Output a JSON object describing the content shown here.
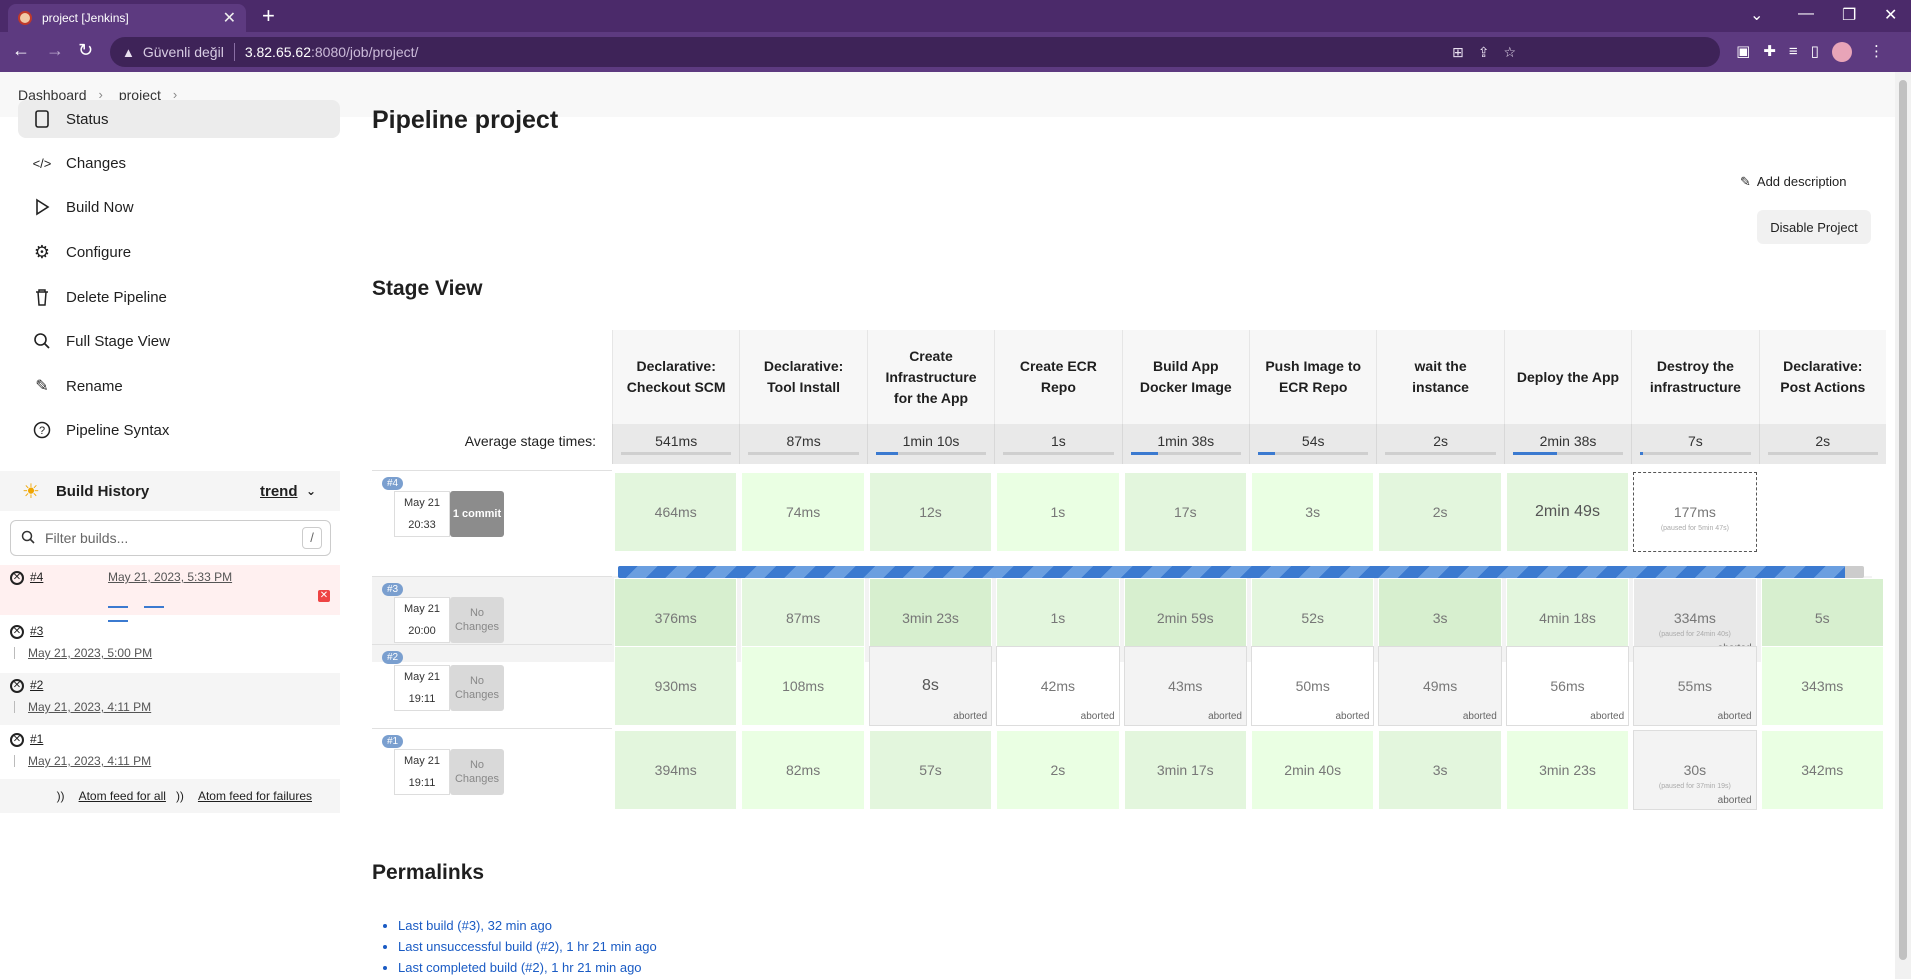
{
  "browser": {
    "tab_title": "project [Jenkins]",
    "security_label": "Güvenli değil",
    "url_host": "3.82.65.62",
    "url_rest": ":8080/job/project/"
  },
  "breadcrumb": [
    "Dashboard",
    "project"
  ],
  "sidebar": {
    "items": [
      {
        "label": "Status",
        "icon": "status-icon"
      },
      {
        "label": "Changes",
        "icon": "code-icon"
      },
      {
        "label": "Build Now",
        "icon": "play-icon"
      },
      {
        "label": "Configure",
        "icon": "gear-icon"
      },
      {
        "label": "Delete Pipeline",
        "icon": "trash-icon"
      },
      {
        "label": "Full Stage View",
        "icon": "search-icon"
      },
      {
        "label": "Rename",
        "icon": "pencil-icon"
      },
      {
        "label": "Pipeline Syntax",
        "icon": "help-icon"
      }
    ],
    "build_history_title": "Build History",
    "trend_label": "trend",
    "filter_placeholder": "Filter builds...",
    "filter_shortcut": "/",
    "builds": [
      {
        "num": "#4",
        "date": "May 21, 2023, 5:33 PM"
      },
      {
        "num": "#3",
        "date": "May 21, 2023, 5:00 PM"
      },
      {
        "num": "#2",
        "date": "May 21, 2023, 4:11 PM"
      },
      {
        "num": "#1",
        "date": "May 21, 2023, 4:11 PM"
      }
    ],
    "feed_all": "Atom feed for all",
    "feed_failures": "Atom feed for failures"
  },
  "main": {
    "title": "Pipeline project",
    "add_description": "Add description",
    "disable_button": "Disable Project",
    "stage_view_title": "Stage View",
    "avg_label": "Average stage times:",
    "permalinks_title": "Permalinks",
    "permalinks": [
      "Last build (#3), 32 min ago",
      "Last unsuccessful build (#2), 1 hr 21 min ago",
      "Last completed build (#2), 1 hr 21 min ago"
    ]
  },
  "stages": [
    {
      "name": "Declarative: Checkout SCM",
      "avg": "541ms",
      "avg_fill": 0.0
    },
    {
      "name": "Declarative: Tool Install",
      "avg": "87ms",
      "avg_fill": 0.0
    },
    {
      "name": "Create Infrastructure for the App",
      "avg": "1min 10s",
      "avg_fill": 0.2
    },
    {
      "name": "Create ECR Repo",
      "avg": "1s",
      "avg_fill": 0.0
    },
    {
      "name": "Build App Docker Image",
      "avg": "1min 38s",
      "avg_fill": 0.25
    },
    {
      "name": "Push Image to ECR Repo",
      "avg": "54s",
      "avg_fill": 0.15
    },
    {
      "name": "wait the instance",
      "avg": "2s",
      "avg_fill": 0.0
    },
    {
      "name": "Deploy the App",
      "avg": "2min 38s",
      "avg_fill": 0.4
    },
    {
      "name": "Destroy the infrastructure",
      "avg": "7s",
      "avg_fill": 0.03
    },
    {
      "name": "Declarative: Post Actions",
      "avg": "2s",
      "avg_fill": 0.0
    }
  ],
  "runs": [
    {
      "badge": "#4",
      "date": "May 21",
      "time": "20:33",
      "changes": "1 commit",
      "cells": [
        {
          "v": "464ms",
          "s": "g1"
        },
        {
          "v": "74ms",
          "s": "g3"
        },
        {
          "v": "12s",
          "s": "g1"
        },
        {
          "v": "1s",
          "s": "g3"
        },
        {
          "v": "17s",
          "s": "g1"
        },
        {
          "v": "3s",
          "s": "g3"
        },
        {
          "v": "2s",
          "s": "g1"
        },
        {
          "v": "2min 49s",
          "s": "g1",
          "big": true
        },
        {
          "v": "177ms",
          "s": "dashed",
          "pause": "(paused for 5min 47s)"
        },
        {
          "v": "",
          "s": "w0"
        }
      ],
      "progress": 0.985
    },
    {
      "badge": "#3",
      "date": "May 21",
      "time": "20:00",
      "changes": "No Changes",
      "cells": [
        {
          "v": "376ms",
          "s": "g2"
        },
        {
          "v": "87ms",
          "s": "g1"
        },
        {
          "v": "3min 23s",
          "s": "g2"
        },
        {
          "v": "1s",
          "s": "g1"
        },
        {
          "v": "2min 59s",
          "s": "g2"
        },
        {
          "v": "52s",
          "s": "g1"
        },
        {
          "v": "3s",
          "s": "g2"
        },
        {
          "v": "4min 18s",
          "s": "g1"
        },
        {
          "v": "334ms",
          "s": "lgray",
          "pause": "(paused for 24min 40s)",
          "note": "aborted"
        },
        {
          "v": "5s",
          "s": "g2"
        }
      ]
    },
    {
      "badge": "#2",
      "date": "May 21",
      "time": "19:11",
      "changes": "No Changes",
      "cells": [
        {
          "v": "930ms",
          "s": "g1"
        },
        {
          "v": "108ms",
          "s": "g3"
        },
        {
          "v": "8s",
          "s": "gray",
          "big": true,
          "note": "aborted"
        },
        {
          "v": "42ms",
          "s": "w",
          "note": "aborted"
        },
        {
          "v": "43ms",
          "s": "gray",
          "note": "aborted"
        },
        {
          "v": "50ms",
          "s": "w",
          "note": "aborted"
        },
        {
          "v": "49ms",
          "s": "gray",
          "note": "aborted"
        },
        {
          "v": "56ms",
          "s": "w",
          "note": "aborted"
        },
        {
          "v": "55ms",
          "s": "gray",
          "note": "aborted"
        },
        {
          "v": "343ms",
          "s": "g3"
        }
      ]
    },
    {
      "badge": "#1",
      "date": "May 21",
      "time": "19:11",
      "changes": "No Changes",
      "cells": [
        {
          "v": "394ms",
          "s": "g1"
        },
        {
          "v": "82ms",
          "s": "g3"
        },
        {
          "v": "57s",
          "s": "g1"
        },
        {
          "v": "2s",
          "s": "g3"
        },
        {
          "v": "3min 17s",
          "s": "g1"
        },
        {
          "v": "2min 40s",
          "s": "g3"
        },
        {
          "v": "3s",
          "s": "g1"
        },
        {
          "v": "3min 23s",
          "s": "g3"
        },
        {
          "v": "30s",
          "s": "gray",
          "pause": "(paused for 37min 19s)",
          "note": "aborted"
        },
        {
          "v": "342ms",
          "s": "g3"
        }
      ]
    }
  ]
}
